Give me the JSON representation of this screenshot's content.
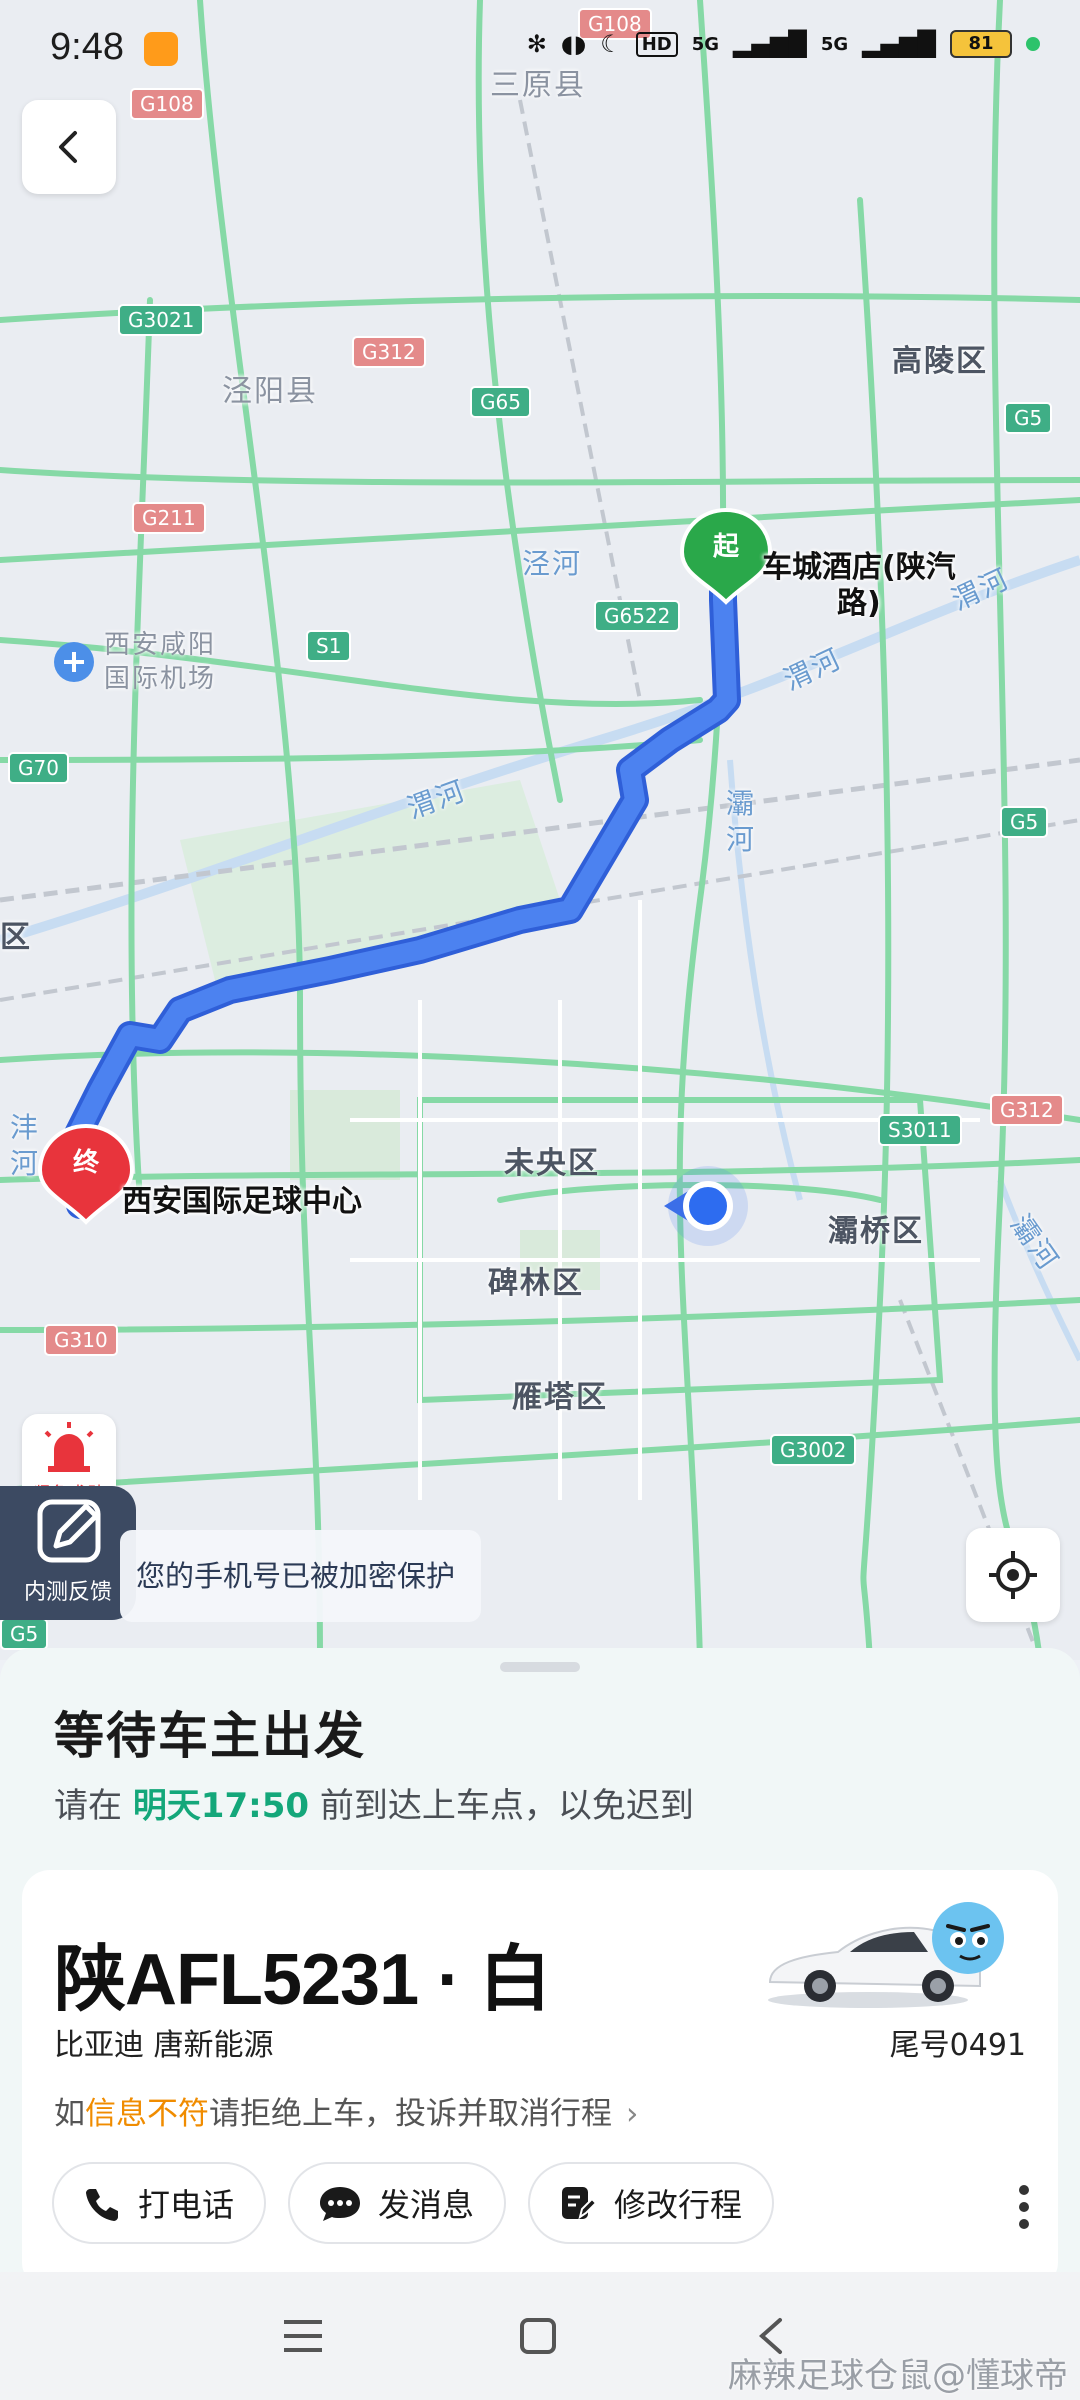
{
  "status_bar": {
    "time": "9:48",
    "network": "5G",
    "network2": "5G",
    "battery": "81",
    "hd_label": "HD"
  },
  "map": {
    "districts": [
      {
        "key": "sanyuan",
        "label": "三原县"
      },
      {
        "key": "gaoling",
        "label": "高陵区"
      },
      {
        "key": "jingyang",
        "label": "泾阳县"
      },
      {
        "key": "weiyang",
        "label": "未央区"
      },
      {
        "key": "baqiao",
        "label": "灞桥区"
      },
      {
        "key": "beilin",
        "label": "碑林区"
      },
      {
        "key": "yanta",
        "label": "雁塔区"
      },
      {
        "key": "qu",
        "label": "区"
      }
    ],
    "airport": "西安咸阳\n国际机场",
    "rivers": {
      "jing": "泾河",
      "wei1": "渭河",
      "wei2": "渭河",
      "ba": "灞\n河",
      "feng": "沣\n河",
      "wei3": "渭河",
      "ba2": "灞河"
    },
    "shields": [
      "G108",
      "G108",
      "G3021",
      "G312",
      "G65",
      "G5",
      "G211",
      "S1",
      "G6522",
      "G70",
      "G5",
      "S3011",
      "G312",
      "G310",
      "G3002",
      "G5"
    ],
    "start_marker": "起",
    "end_marker": "终",
    "start_name": "车城酒店(陕汽\n路)",
    "end_name": "西安国际足球中心"
  },
  "overlay": {
    "sos_label": "紧急求助",
    "feedback_label": "内测反馈",
    "phone_tip": "您的手机号已被加密保护"
  },
  "sheet": {
    "title": "等待车主出发",
    "sub_prefix": "请在",
    "sub_time": "明天17:50",
    "sub_suffix": "前到达上车点，以免迟到",
    "plate": "陕AFL5231 · 白",
    "model": "比亚迪 唐新能源",
    "tail": "尾号0491",
    "warn_prefix": "如",
    "warn_highlight": "信息不符",
    "warn_suffix": "请拒绝上车，投诉并取消行程",
    "actions": {
      "call": "打电话",
      "message": "发消息",
      "modify": "修改行程"
    }
  },
  "watermark": "麻辣足球仓鼠@懂球帝",
  "colors": {
    "route": "#3b6ee8",
    "accent": "#14a77a",
    "warn": "#f08c00",
    "start": "#2aa84a",
    "end": "#e8343c"
  }
}
